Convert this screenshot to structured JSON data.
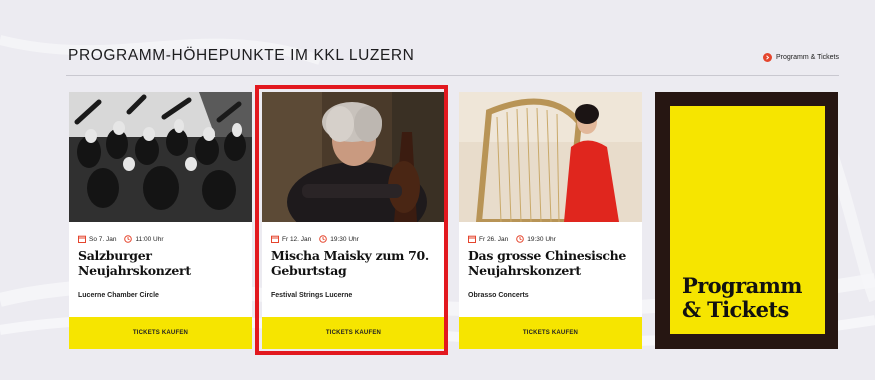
{
  "section": {
    "title": "PROGRAMM-HÖHEPUNKTE IM KKL LUZERN",
    "link_label": "Programm & Tickets"
  },
  "cards": [
    {
      "date": "So 7. Jan",
      "time": "11:00 Uhr",
      "title": "Salzburger Neujahrskonzert",
      "artist": "Lucerne Chamber Circle",
      "button": "TICKETS KAUFEN"
    },
    {
      "date": "Fr 12. Jan",
      "time": "19:30 Uhr",
      "title": "Mischa Maisky zum 70. Geburtstag",
      "artist": "Festival Strings Lucerne",
      "button": "TICKETS KAUFEN"
    },
    {
      "date": "Fr 26. Jan",
      "time": "19:30 Uhr",
      "title": "Das grosse Chinesische Neujahrskonzert",
      "artist": "Obrasso Concerts",
      "button": "TICKETS KAUFEN"
    }
  ],
  "promo": {
    "title_line1": "Programm",
    "title_line2": "& Tickets"
  },
  "colors": {
    "accent_yellow": "#f6e500",
    "accent_red": "#e5452d",
    "highlight_red": "#e2181f",
    "promo_frame": "#261612",
    "page_background": "#ecebf1"
  },
  "icons": {
    "link": "circle-arrow-icon",
    "date": "calendar-icon",
    "time": "clock-icon"
  }
}
